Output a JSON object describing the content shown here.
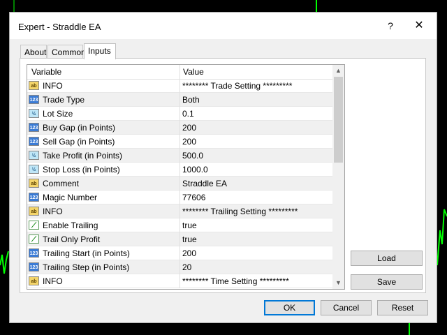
{
  "window": {
    "title": "Expert - Straddle EA",
    "help_label": "?",
    "close_label": "✕"
  },
  "tabs": [
    {
      "label": "About",
      "active": false
    },
    {
      "label": "Common",
      "active": false
    },
    {
      "label": "Inputs",
      "active": true
    }
  ],
  "grid": {
    "columns": [
      "Variable",
      "Value"
    ],
    "rows": [
      {
        "icon": "ab",
        "icon_text": "ab",
        "variable": "INFO",
        "value": "******** Trade Setting *********"
      },
      {
        "icon": "123",
        "icon_text": "123",
        "variable": "Trade Type",
        "value": "Both"
      },
      {
        "icon": "v12",
        "icon_text": "½",
        "variable": "Lot Size",
        "value": "0.1"
      },
      {
        "icon": "123",
        "icon_text": "123",
        "variable": "Buy Gap (in Points)",
        "value": "200"
      },
      {
        "icon": "123",
        "icon_text": "123",
        "variable": "Sell Gap (in Points)",
        "value": "200"
      },
      {
        "icon": "v12",
        "icon_text": "½",
        "variable": "Take Profit (in Points)",
        "value": "500.0"
      },
      {
        "icon": "v12",
        "icon_text": "½",
        "variable": "Stop Loss (in Points)",
        "value": "1000.0"
      },
      {
        "icon": "ab",
        "icon_text": "ab",
        "variable": "Comment",
        "value": "Straddle EA"
      },
      {
        "icon": "123",
        "icon_text": "123",
        "variable": "Magic Number",
        "value": "77606"
      },
      {
        "icon": "ab",
        "icon_text": "ab",
        "variable": "INFO",
        "value": "******** Trailing Setting *********"
      },
      {
        "icon": "bool",
        "icon_text": "⟋",
        "variable": "Enable Trailing",
        "value": "true"
      },
      {
        "icon": "bool",
        "icon_text": "⟋",
        "variable": "Trail Only Profit",
        "value": "true"
      },
      {
        "icon": "123",
        "icon_text": "123",
        "variable": "Trailing Start (in Points)",
        "value": "200"
      },
      {
        "icon": "123",
        "icon_text": "123",
        "variable": "Trailing Step (in Points)",
        "value": "20"
      },
      {
        "icon": "ab",
        "icon_text": "ab",
        "variable": "INFO",
        "value": "******** Time Setting *********"
      }
    ],
    "scroll_up": "▲",
    "scroll_down": "▼"
  },
  "side_buttons": {
    "load": "Load",
    "save": "Save"
  },
  "footer_buttons": {
    "ok": "OK",
    "cancel": "Cancel",
    "reset": "Reset"
  },
  "colors": {
    "chart_background": "#000000",
    "chart_line": "#00ff00",
    "accent": "#0078d7"
  }
}
